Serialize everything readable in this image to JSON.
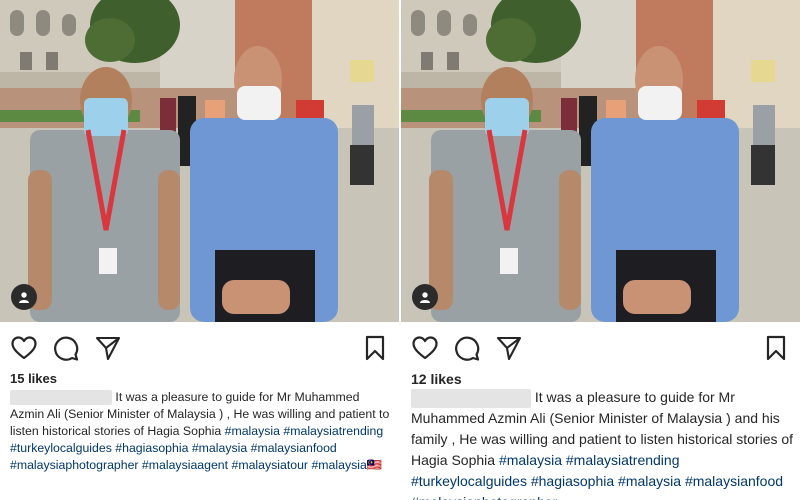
{
  "icons": {
    "like": "heart-icon",
    "comment": "comment-icon",
    "share": "paper-plane-icon",
    "save": "bookmark-icon",
    "tag": "person-tag-icon"
  },
  "colors": {
    "text": "#262626",
    "hashtag": "#00376b",
    "blur": "#e4e4e4"
  },
  "posts": [
    {
      "likes": "15 likes",
      "caption": " It was a pleasure to guide for Mr Muhammed Azmin Ali (Senior Minister of Malaysia ) , He was willing and patient to listen historical stories of Hagia Sophia",
      "hashtags": " #malaysia #malaysiatrending #turkeylocalguides #hagiasophia #malaysia #malaysianfood #malaysiaphotographer #malaysiaagent #malaysiatour #malaysia🇲🇾"
    },
    {
      "likes": "12 likes",
      "caption": " It was a pleasure to guide for Mr Muhammed Azmin Ali (Senior Minister of Malaysia ) and his family , He was willing and patient to listen historical stories of Hagia Sophia",
      "hashtags": " #malaysia #malaysiatrending #turkeylocalguides #hagiasophia #malaysia #malaysianfood #malaysiaphotographer"
    }
  ]
}
